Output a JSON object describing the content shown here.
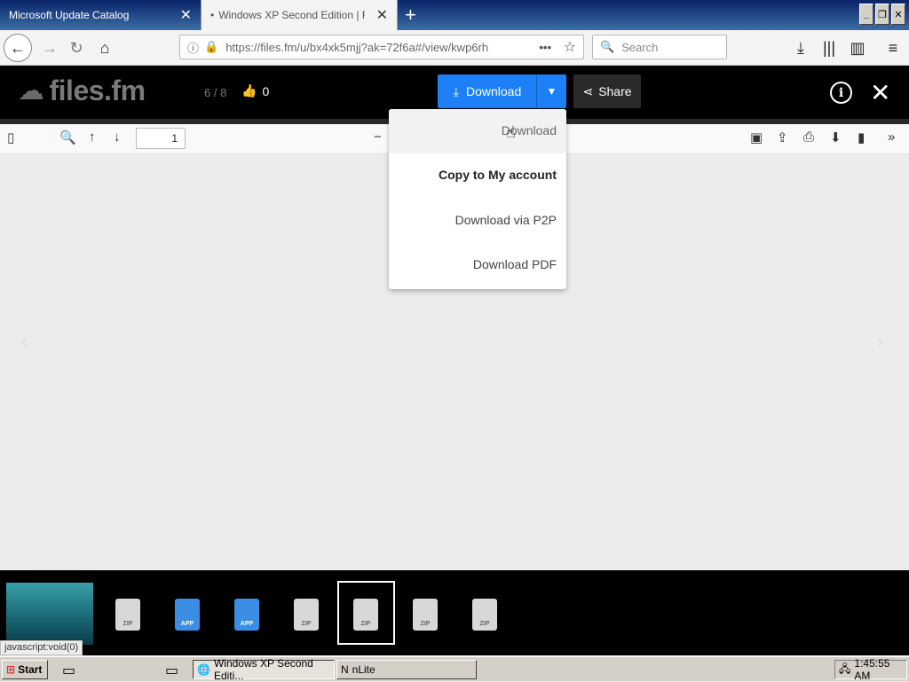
{
  "browser": {
    "tabs": [
      {
        "label": "Microsoft Update Catalog",
        "active": false
      },
      {
        "label": "Windows XP Second Edition | Files",
        "active": true
      }
    ],
    "url": "https://files.fm/u/bx4xk5mjj?ak=72f6a#/view/kwp6rh",
    "search_placeholder": "Search"
  },
  "header": {
    "logo_text": "files.fm",
    "counter": "6 / 8",
    "likes": "0",
    "download_label": "Download",
    "share_label": "Share"
  },
  "pdf_toolbar": {
    "page_number": "1"
  },
  "dropdown": {
    "items": [
      "Download",
      "Copy to My account",
      "Download via P2P",
      "Download PDF"
    ]
  },
  "thumbnails": [
    {
      "type": "image",
      "label": ""
    },
    {
      "type": "zip",
      "label": "ZIP"
    },
    {
      "type": "app",
      "label": "APP"
    },
    {
      "type": "app",
      "label": "APP"
    },
    {
      "type": "zip",
      "label": "ZIP"
    },
    {
      "type": "zip",
      "label": "ZIP"
    },
    {
      "type": "zip",
      "label": "ZIP"
    },
    {
      "type": "zip",
      "label": "ZIP"
    }
  ],
  "status_bar_link": "javascript:void(0)",
  "taskbar": {
    "start_label": "Start",
    "windows": [
      {
        "label": "Windows XP Second Editi...",
        "active": true
      },
      {
        "label": "nLite",
        "active": false
      }
    ],
    "clock": "1:45:55 AM"
  },
  "colors": {
    "accent": "#1d80f7",
    "header_bg": "#000000",
    "titlebar": "#0a246a"
  }
}
